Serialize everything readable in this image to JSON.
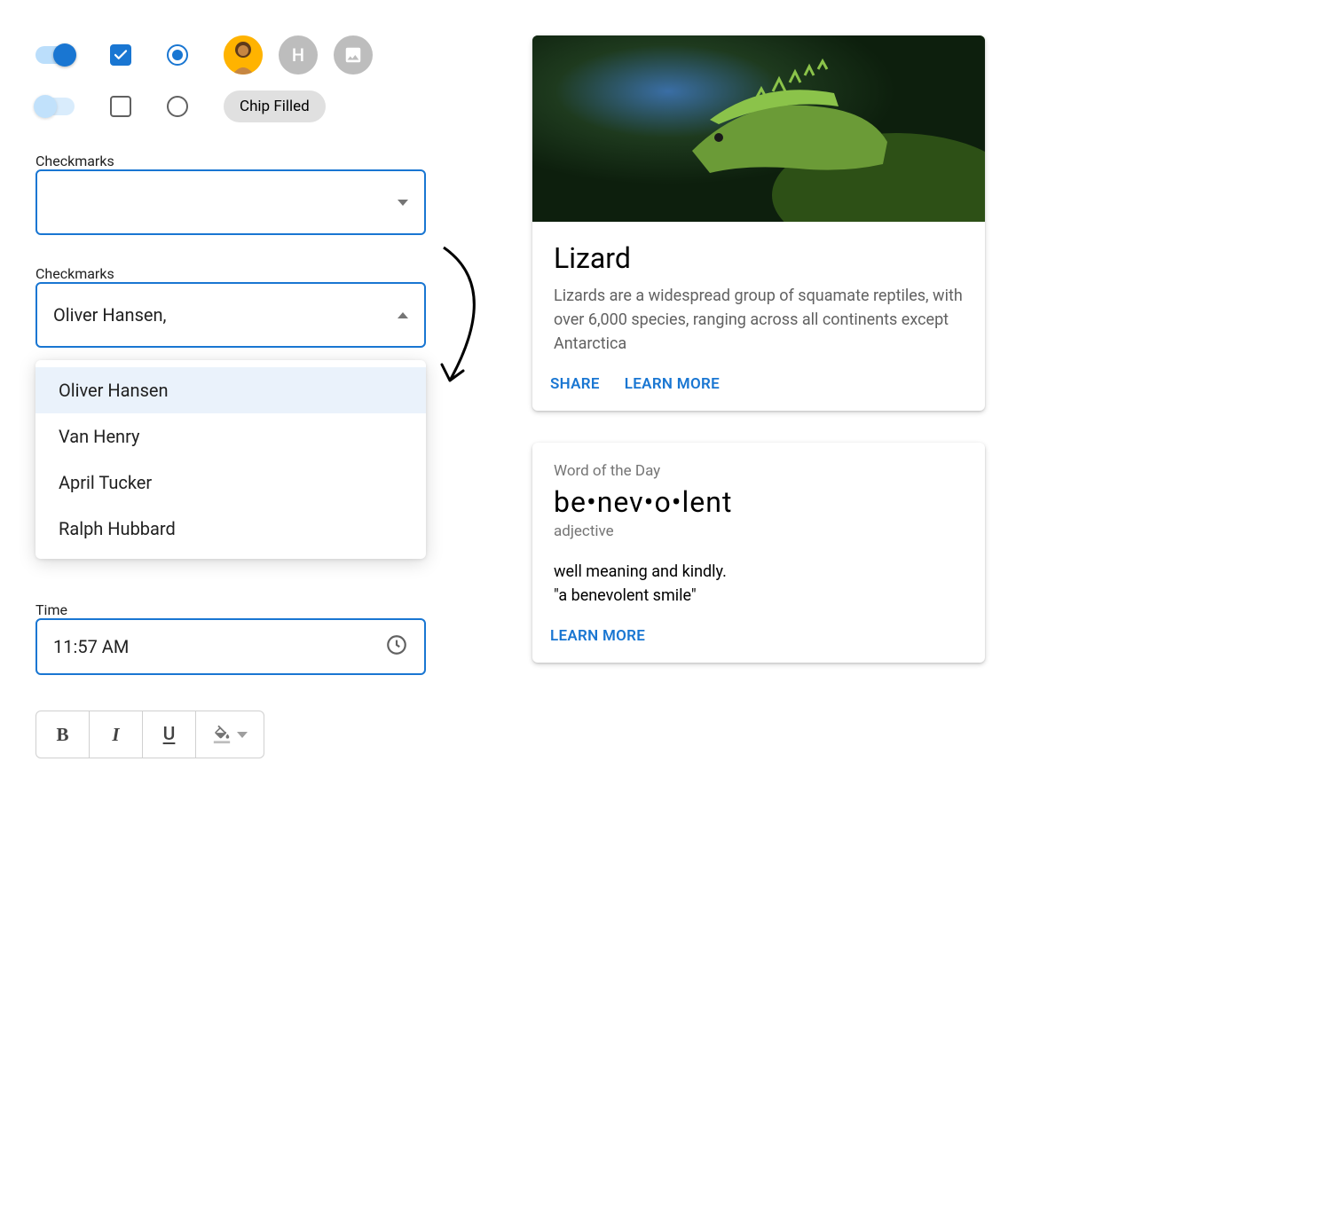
{
  "controls": {
    "avatars": {
      "letter": "H"
    },
    "chip_label": "Chip Filled"
  },
  "select1": {
    "label": "Checkmarks",
    "value": ""
  },
  "select2": {
    "label": "Checkmarks",
    "value": "Oliver Hansen,",
    "options": [
      "Oliver Hansen",
      "Van Henry",
      "April Tucker",
      "Ralph Hubbard"
    ],
    "selected_index": 0
  },
  "time_field": {
    "label": "Time",
    "value": "11:57 AM"
  },
  "format_buttons": {
    "bold": "B",
    "italic": "I",
    "underline": "U"
  },
  "card_lizard": {
    "title": "Lizard",
    "text": "Lizards are a widespread group of squamate reptiles, with over 6,000 species, ranging across all continents except Antarctica",
    "action_share": "SHARE",
    "action_learn": "LEARN MORE"
  },
  "card_wotd": {
    "label": "Word of the Day",
    "word": "be•nev•o•lent",
    "pos": "adjective",
    "definition1": "well meaning and kindly.",
    "definition2": "\"a benevolent smile\"",
    "action_learn": "LEARN MORE"
  }
}
